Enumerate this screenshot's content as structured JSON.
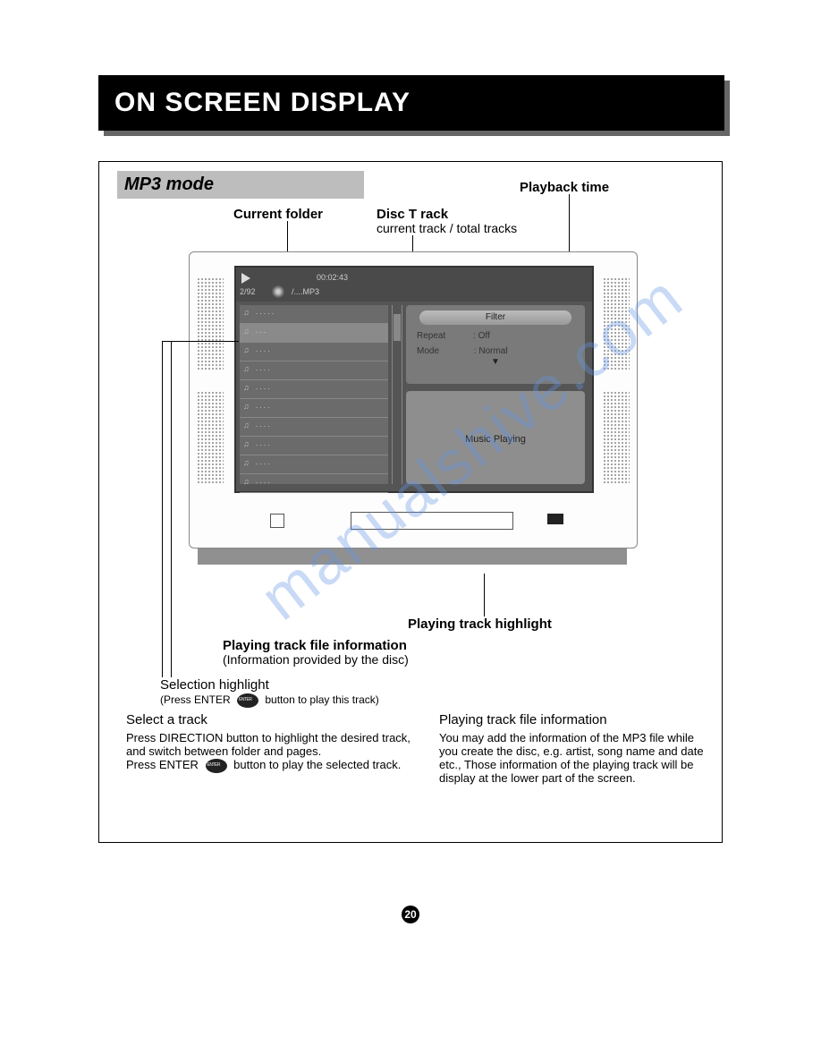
{
  "header": {
    "title": "ON SCREEN DISPLAY"
  },
  "mode_label": "MP3 mode",
  "annotations": {
    "playback_time": "Playback  time",
    "current_folder": "Current folder",
    "disc_track": "Disc T rack",
    "disc_track_sub": "current track / total tracks",
    "playing_track_highlight": "Playing track  highlight",
    "playing_track_file_info": "Playing track   file information",
    "playing_track_file_info_sub": "(Information provided by  the disc)",
    "selection_highlight": "Selection highlight",
    "selection_highlight_sub_pre": "(Press  ENTER",
    "selection_highlight_sub_post": "button to play   this track)"
  },
  "osd": {
    "track_counter": "2/92",
    "time": "00:02:43",
    "path": "/....MP3",
    "filter": "Filter",
    "repeat_label": "Repeat",
    "repeat_value": ":  Off",
    "mode_label": "Mode",
    "mode_value": ":  Normal",
    "music_playing": "Music Playing",
    "track_items": [
      ". . . . .",
      ". . .",
      ". . . .",
      ". . . .",
      ". . . .",
      ". . . .",
      ". . . .",
      ". . . .",
      ". . . .",
      ". . . ."
    ]
  },
  "left_col": {
    "title": "Select a  track",
    "line1": "Press  DIRECTION   button to highlight the desired track, and  switch between folder and pages.",
    "line2_pre": "Press  ENTER",
    "line2_post": "button to play  the selected track."
  },
  "right_col": {
    "title": "Playing track  file information",
    "body": "You  may add the  information of the   MP3 file while you create    the disc, e.g.  artist, song name and date etc.,     Those information of    the playing track will be   display at the   lower part of   the screen."
  },
  "page_number": "20",
  "watermark": "manualshive.com"
}
